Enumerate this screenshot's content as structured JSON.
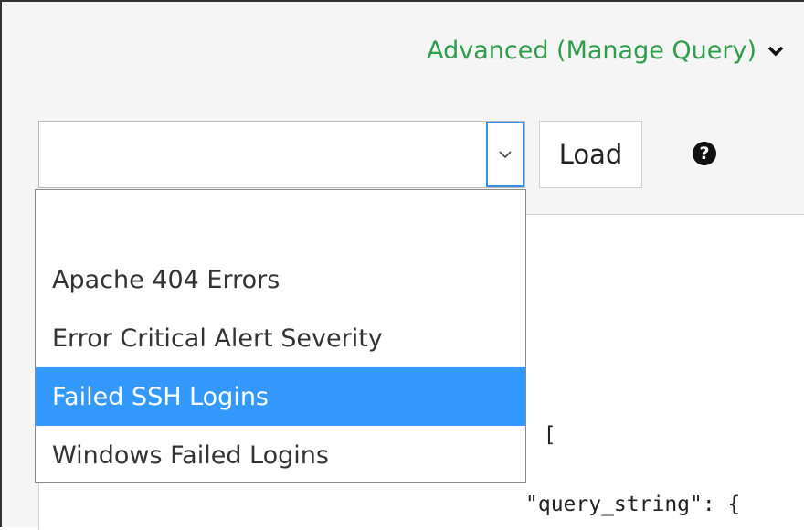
{
  "header": {
    "advanced_label": "Advanced (Manage Query)",
    "accent_color": "#2e9e4a"
  },
  "query_select": {
    "value": "",
    "options": [
      "",
      "Apache 404 Errors",
      "Error Critical Alert Severity",
      "Failed SSH Logins",
      "Windows Failed Logins"
    ],
    "highlighted": "Failed SSH Logins",
    "highlight_color": "#3399ff"
  },
  "toolbar": {
    "load_label": "Load",
    "help_glyph": "?"
  },
  "editor": {
    "line_bracket": ": [",
    "line_query_string": "\"query_string\": {"
  },
  "icons": {
    "chevron": "chevron-down-icon",
    "help": "question-circle-icon"
  }
}
